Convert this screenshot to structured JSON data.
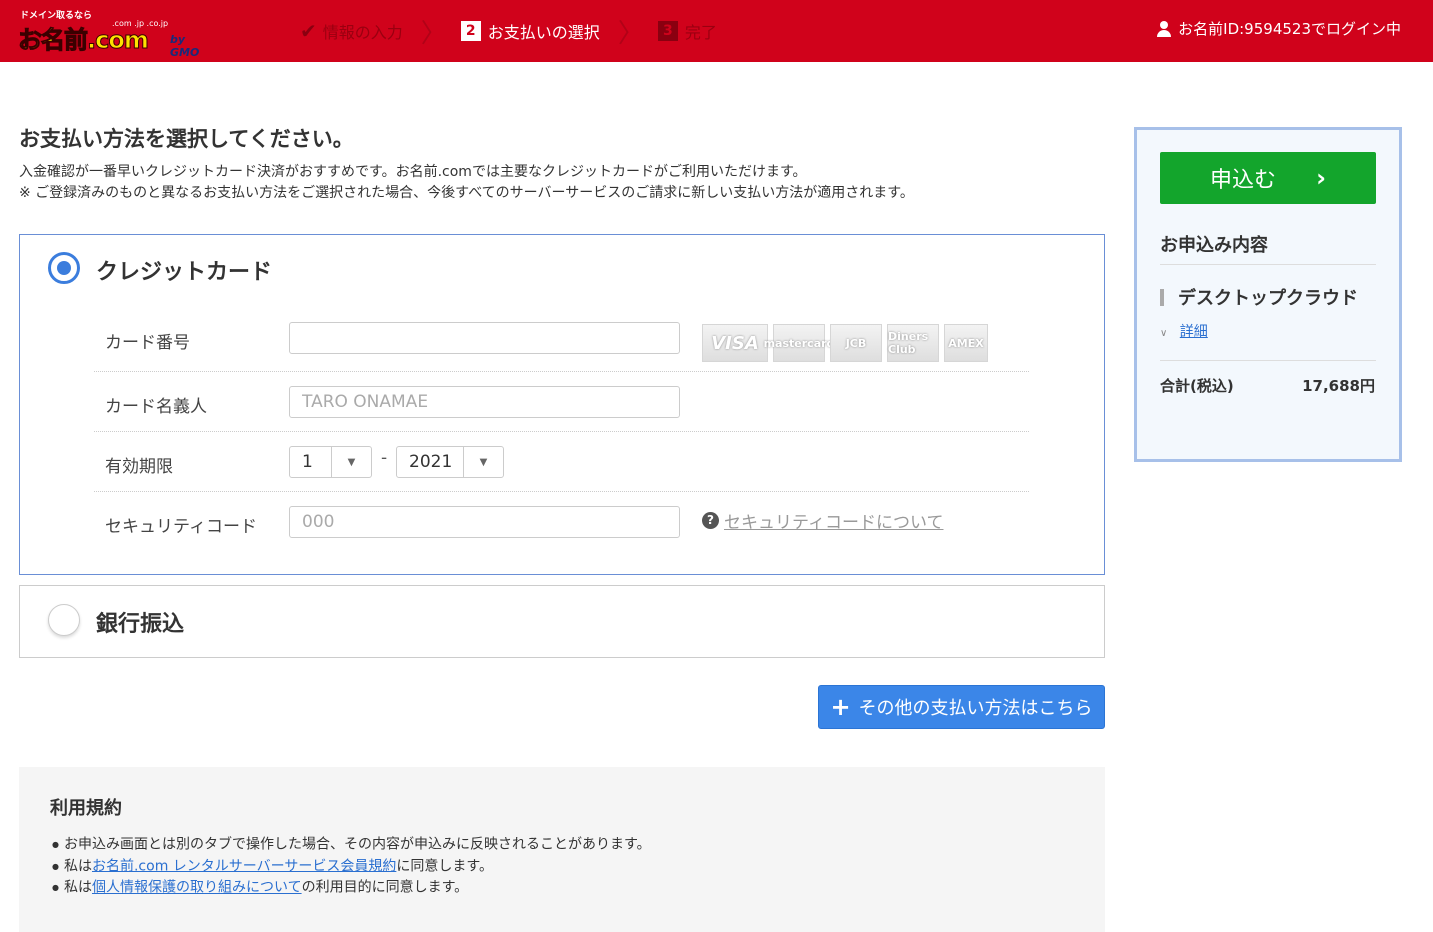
{
  "header": {
    "logo_tagline": "ドメイン取るなら",
    "logo_ext": ".com .jp .co.jp",
    "logo_name": "お名前.com",
    "logo_by": "by GMO",
    "steps": [
      {
        "label": "情報の入力",
        "num": ""
      },
      {
        "label": "お支払いの選択",
        "num": "2"
      },
      {
        "label": "完了",
        "num": "3"
      }
    ],
    "login_text": "お名前ID:9594523でログイン中"
  },
  "main": {
    "title": "お支払い方法を選択してください。",
    "desc_line1": "入金確認が一番早いクレジットカード決済がおすすめです。お名前.comでは主要なクレジットカードがご利用いただけます。",
    "desc_line2": "※ ご登録済みのものと異なるお支払い方法をご選択された場合、今後すべてのサーバーサービスのご請求に新しい支払い方法が適用されます。"
  },
  "credit": {
    "label": "クレジットカード",
    "card_number_label": "カード番号",
    "card_number_value": "",
    "card_logos": [
      "VISA",
      "mastercard",
      "JCB",
      "Diners Club",
      "AMEX"
    ],
    "holder_label": "カード名義人",
    "holder_placeholder": "TARO ONAMAE",
    "expiry_label": "有効期限",
    "expiry_month": "1",
    "expiry_sep": "-",
    "expiry_year": "2021",
    "cvc_label": "セキュリティコード",
    "cvc_placeholder": "000",
    "cvc_help": "セキュリティコードについて"
  },
  "bank": {
    "label": "銀行振込"
  },
  "other_button": "その他の支払い方法はこちら",
  "terms": {
    "title": "利用規約",
    "item1": "お申込み画面とは別のタブで操作した場合、その内容が申込みに反映されることがあります。",
    "item2_pre": "私は",
    "item2_link": "お名前.com レンタルサーバーサービス会員規約",
    "item2_post": "に同意します。",
    "item3_pre": "私は",
    "item3_link": "個人情報保護の取り組みについて",
    "item3_post": "の利用目的に同意します。"
  },
  "sidebar": {
    "apply_label": "申込む",
    "summary_title": "お申込み内容",
    "product": "デスクトップクラウド",
    "detail_link": "詳細",
    "total_label": "合計(税込)",
    "total_value": "17,688円"
  },
  "colors": {
    "brand_red": "#d0021b",
    "accent_blue": "#3b7ddd",
    "apply_green": "#13a52c"
  }
}
